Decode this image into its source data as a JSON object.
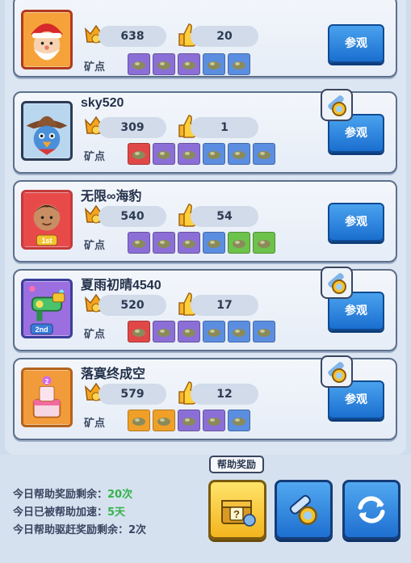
{
  "players": [
    {
      "name": "",
      "rank_score": "638",
      "likes": "20",
      "mine_label": "矿点",
      "visit_label": "参观",
      "slots": [
        "purple",
        "purple",
        "purple",
        "blue",
        "blue"
      ],
      "avatar": "santa-avatar",
      "has_mag": true
    },
    {
      "name": "sky520",
      "rank_score": "309",
      "likes": "1",
      "mine_label": "矿点",
      "visit_label": "参观",
      "slots": [
        "red",
        "purple",
        "purple",
        "blue",
        "blue",
        "blue"
      ],
      "avatar": "cowboy-bird-avatar",
      "has_mag": true
    },
    {
      "name": "无限∞海豹",
      "rank_score": "540",
      "likes": "54",
      "mine_label": "矿点",
      "visit_label": "参观",
      "slots": [
        "purple",
        "purple",
        "purple",
        "blue",
        "green",
        "green"
      ],
      "avatar": "first-place-avatar",
      "has_mag": false
    },
    {
      "name": "夏雨初晴4540",
      "rank_score": "520",
      "likes": "17",
      "mine_label": "矿点",
      "visit_label": "参观",
      "slots": [
        "red",
        "purple",
        "purple",
        "blue",
        "blue",
        "blue"
      ],
      "avatar": "second-place-avatar",
      "has_mag": true
    },
    {
      "name": "落寞终成空",
      "rank_score": "579",
      "likes": "12",
      "mine_label": "矿点",
      "visit_label": "参观",
      "slots": [
        "orange",
        "orange",
        "purple",
        "purple",
        "blue"
      ],
      "avatar": "cake-avatar",
      "has_mag": true
    }
  ],
  "footer": {
    "help_reward_left_label": "今日帮助奖励剩余：",
    "help_reward_left_value": "20次",
    "helped_speed_label": "今日已被帮助加速：",
    "helped_speed_value": "5天",
    "expel_reward_label": "今日帮助驱赶奖励剩余：",
    "expel_reward_value": "2次",
    "help_reward_tag": "帮助奖励"
  },
  "colors": {
    "slot_purple": "#8b6fd6",
    "slot_blue": "#5b8ee0",
    "slot_red": "#e04848",
    "slot_green": "#6cc24a",
    "slot_orange": "#f0a028",
    "visit_button": "#2f86e0",
    "highlight_green": "#35b34a"
  },
  "icons": {
    "rank": "crown-badge-icon",
    "likes": "thumbs-up-icon",
    "magnifier": "magnifier-icon",
    "gift": "mystery-chest-icon",
    "search": "magnifier-icon",
    "refresh": "refresh-icon"
  }
}
